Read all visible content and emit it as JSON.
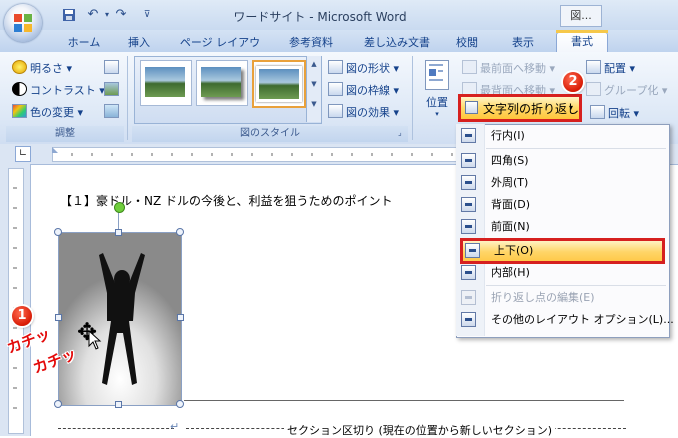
{
  "window": {
    "title": "ワードサイト - Microsoft Word",
    "extra_window": "図..."
  },
  "qat": {
    "save_icon": "save-icon",
    "undo_icon": "undo-icon",
    "redo_icon": "redo-icon"
  },
  "tabs": [
    {
      "label": "ホーム"
    },
    {
      "label": "挿入"
    },
    {
      "label": "ページ レイアウト"
    },
    {
      "label": "参考資料"
    },
    {
      "label": "差し込み文書"
    },
    {
      "label": "校閲"
    },
    {
      "label": "表示"
    },
    {
      "label": "書式"
    }
  ],
  "ribbon": {
    "adjust": {
      "brightness": "明るさ",
      "contrast": "コントラスト",
      "recolor": "色の変更",
      "label": "調整"
    },
    "styles": {
      "shape": "図の形状",
      "border": "図の枠線",
      "effects": "図の効果",
      "label": "図のスタイル"
    },
    "arrange": {
      "position": "位置",
      "bring_front": "最前面へ移動",
      "send_back": "最背面へ移動",
      "align": "配置",
      "group": "グループ化",
      "rotate": "回転",
      "wrap": "文字列の折り返し"
    }
  },
  "document": {
    "heading": "【１】豪ドル・NZ ドルの今後と、利益を狙うためのポイント",
    "section_break": "セクション区切り (現在の位置から新しいセクション)",
    "sound_effect_1": "カチッ",
    "sound_effect_2": "カチッ"
  },
  "callouts": {
    "one": "1",
    "two": "2",
    "three": "3"
  },
  "menu": {
    "items": [
      {
        "label": "行内(I)",
        "enabled": true
      },
      {
        "label": "四角(S)",
        "enabled": true
      },
      {
        "label": "外周(T)",
        "enabled": true
      },
      {
        "label": "背面(D)",
        "enabled": true
      },
      {
        "label": "前面(N)",
        "enabled": true
      },
      {
        "label": "上下(O)",
        "enabled": true,
        "highlighted": true
      },
      {
        "label": "内部(H)",
        "enabled": true
      },
      {
        "label": "折り返し点の編集(E)",
        "enabled": false
      },
      {
        "label": "その他のレイアウト オプション(L)...",
        "enabled": true
      }
    ]
  },
  "colors": {
    "accent_red": "#d6201f",
    "highlight": "#ffd567",
    "ribbon": "#dde8f6"
  }
}
